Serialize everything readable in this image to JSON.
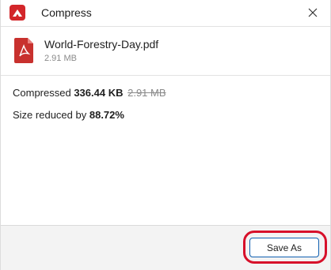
{
  "window": {
    "title": "Compress",
    "app_icon": "compress-app-icon",
    "close_icon": "close-icon"
  },
  "file": {
    "name": "World-Forestry-Day.pdf",
    "size": "2.91 MB",
    "icon": "pdf-file-icon"
  },
  "result": {
    "compressed_label": "Compressed",
    "compressed_size": "336.44 KB",
    "original_size": "2.91 MB",
    "reduced_label": "Size reduced by",
    "reduced_percent": "88.72%"
  },
  "footer": {
    "save_as_label": "Save As"
  },
  "colors": {
    "accent_red": "#d3262a",
    "button_border": "#0f5fb0",
    "highlight": "#d7102a"
  }
}
